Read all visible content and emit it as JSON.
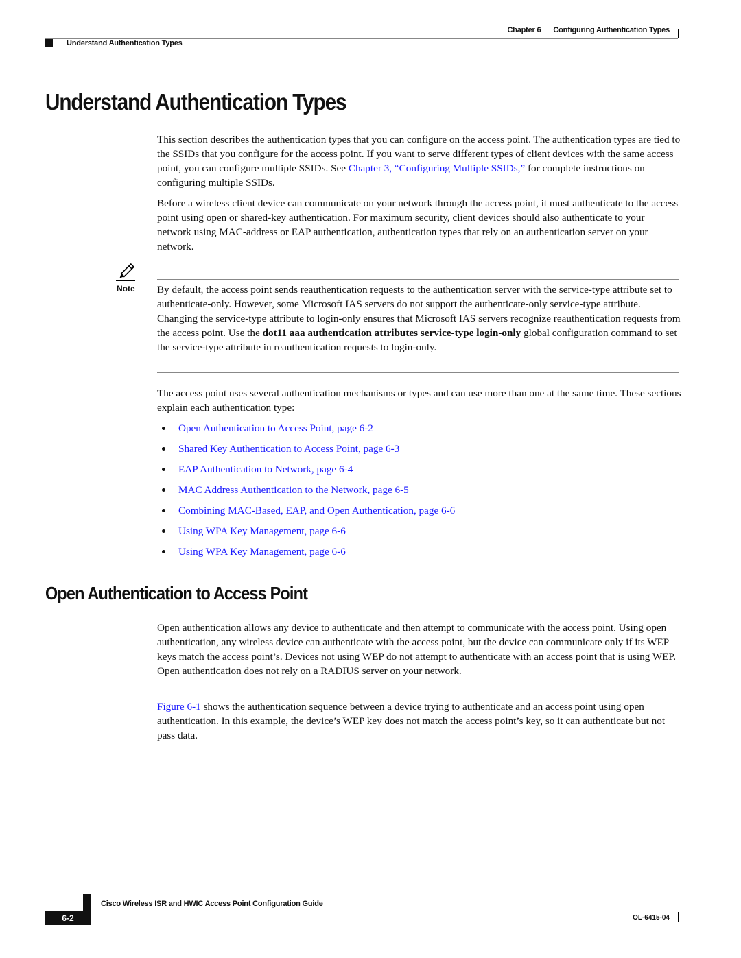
{
  "header": {
    "chapter_label": "Chapter 6",
    "chapter_title": "Configuring Authentication Types",
    "section_title": "Understand Authentication Types"
  },
  "main": {
    "title": "Understand Authentication Types",
    "intro_paragraph": {
      "text_before_link": "This section describes the authentication types that you can configure on the access point. The authentication types are tied to the SSIDs that you configure for the access point. If you want to serve different types of client devices with the same access point, you can configure multiple SSIDs. See ",
      "link": "Chapter 3, “Configuring Multiple SSIDs,”",
      "text_after_link": " for complete instructions on configuring multiple SSIDs."
    },
    "paragraph_2": "Before a wireless client device can communicate on your network through the access point, it must authenticate to the access point using open or shared-key authentication. For maximum security, client devices should also authenticate to your network using MAC-address or EAP authentication, authentication types that rely on an authentication server on your network.",
    "note": {
      "label": "Note",
      "icon": "pencil-icon",
      "text_1": "By default, the access point sends reauthentication requests to the authentication server with the service-type attribute set to authenticate-only. However, some Microsoft IAS servers do not support the authenticate-only service-type attribute. Changing the service-type attribute to login-only ensures that Microsoft IAS servers recognize reauthentication requests from the access point. Use the ",
      "command": "dot11 aaa authentication attributes service-type login-only",
      "text_2": " global configuration command to set the service-type attribute in reauthentication requests to login-only."
    },
    "paragraph_3": "The access point uses several authentication mechanisms or types and can use more than one at the same time. These sections explain each authentication type:",
    "bullets": [
      "Open Authentication to Access Point, page 6-2",
      "Shared Key Authentication to Access Point, page 6-3",
      "EAP Authentication to Network, page 6-4",
      "MAC Address Authentication to the Network, page 6-5",
      "Combining MAC-Based, EAP, and Open Authentication, page 6-6",
      "Using WPA Key Management, page 6-6",
      "Using WPA Key Management, page 6-6"
    ],
    "subsection": {
      "title": "Open Authentication to Access Point",
      "paragraph_1": "Open authentication allows any device to authenticate and then attempt to communicate with the access point. Using open authentication, any wireless device can authenticate with the access point, but the device can communicate only if its WEP keys match the access point’s. Devices not using WEP do not attempt to authenticate with an access point that is using WEP. Open authentication does not rely on a RADIUS server on your network.",
      "paragraph_2_link": "Figure 6-1",
      "paragraph_2_text": " shows the authentication sequence between a device trying to authenticate and an access point using open authentication. In this example, the device’s WEP key does not match the access point’s key, so it can authenticate but not pass data."
    }
  },
  "footer": {
    "guide_title": "Cisco Wireless ISR and HWIC Access Point Configuration Guide",
    "page_number": "6-2",
    "doc_number": "OL-6415-04"
  },
  "colors": {
    "link": "#1a1aff",
    "text": "#111111",
    "rule": "#888888"
  }
}
